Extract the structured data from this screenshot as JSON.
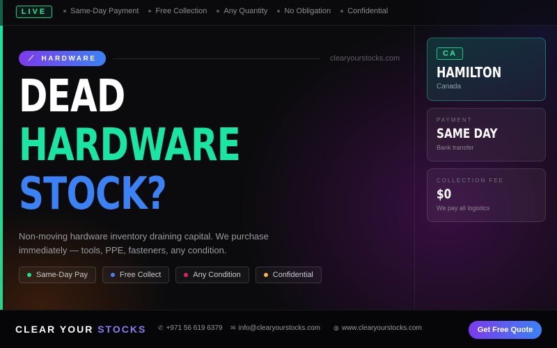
{
  "ticker": {
    "live_label": "LIVE",
    "items": [
      "Same-Day Payment",
      "Free Collection",
      "Any Quantity",
      "No Obligation",
      "Confidential"
    ]
  },
  "hero": {
    "category": "HARDWARE",
    "category_icon": "wrench-icon",
    "website": "clearyourstocks.com",
    "headline": [
      "DEAD",
      "HARDWARE",
      "STOCK?"
    ],
    "description": "Non-moving hardware inventory draining capital. We purchase immediately — tools, PPE, fasteners, any condition.",
    "tags": [
      {
        "label": "Same-Day Pay",
        "color": "#22e08a"
      },
      {
        "label": "Free Collect",
        "color": "#4f7df5"
      },
      {
        "label": "Any Condition",
        "color": "#e0245e"
      },
      {
        "label": "Confidential",
        "color": "#f5b83a"
      }
    ]
  },
  "location_card": {
    "code": "CA",
    "city": "HAMILTON",
    "country": "Canada"
  },
  "info_cards": [
    {
      "label": "PAYMENT",
      "value": "SAME DAY",
      "sub": "Bank transfer"
    },
    {
      "label": "COLLECTION FEE",
      "value": "$0",
      "sub": "We pay all logistics"
    }
  ],
  "footer": {
    "brand_part1": "CLEAR YOUR ",
    "brand_part2": "STOCKS",
    "phone": "+971 56 619 6379",
    "email": "info@clearyourstocks.com",
    "website": "www.clearyourstocks.com",
    "cta": "Get Free Quote"
  },
  "colors": {
    "accent_green": "#19e6a2",
    "accent_blue": "#3b82f6",
    "accent_purple": "#7c3aed"
  }
}
